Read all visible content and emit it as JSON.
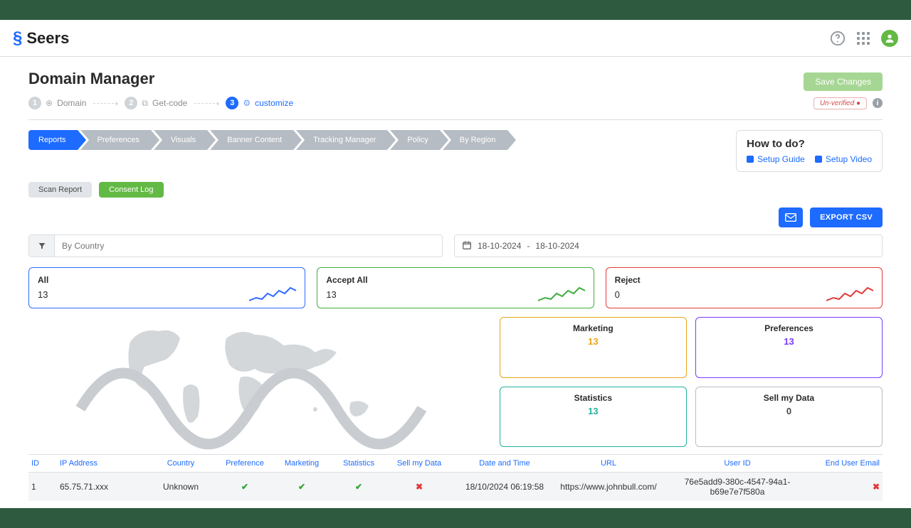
{
  "brand": "Seers",
  "header": {
    "save_label": "Save Changes"
  },
  "page_title": "Domain Manager",
  "steps": [
    {
      "num": "1",
      "label": "Domain"
    },
    {
      "num": "2",
      "label": "Get-code"
    },
    {
      "num": "3",
      "label": "customize"
    }
  ],
  "verification": {
    "label": "Un-verified"
  },
  "tabs": [
    "Reports",
    "Preferences",
    "Visuals",
    "Banner Content",
    "Tracking Manager",
    "Policy",
    "By Region"
  ],
  "help": {
    "title": "How to do?",
    "guide": "Setup Guide",
    "video": "Setup Video"
  },
  "subtabs": {
    "scan": "Scan Report",
    "consent": "Consent Log"
  },
  "actions": {
    "export": "EXPORT CSV"
  },
  "filter": {
    "placeholder": "By Country"
  },
  "date_range": {
    "from": "18-10-2024",
    "sep": "-",
    "to": "18-10-2024"
  },
  "stats": {
    "all": {
      "label": "All",
      "value": "13"
    },
    "accept": {
      "label": "Accept All",
      "value": "13"
    },
    "reject": {
      "label": "Reject",
      "value": "0"
    }
  },
  "mini": {
    "marketing": {
      "label": "Marketing",
      "value": "13"
    },
    "preferences": {
      "label": "Preferences",
      "value": "13"
    },
    "statistics": {
      "label": "Statistics",
      "value": "13"
    },
    "sell": {
      "label": "Sell my Data",
      "value": "0"
    }
  },
  "table": {
    "headers": [
      "ID",
      "IP Address",
      "Country",
      "Preference",
      "Marketing",
      "Statistics",
      "Sell my Data",
      "Date and Time",
      "URL",
      "User ID",
      "End User Email"
    ],
    "rows": [
      {
        "id": "1",
        "ip": "65.75.71.xxx",
        "country": "Unknown",
        "preference": true,
        "marketing": true,
        "statistics": true,
        "sell": false,
        "datetime": "18/10/2024 06:19:58",
        "url": "https://www.johnbull.com/",
        "user_id": "76e5add9-380c-4547-94a1-b69e7e7f580a",
        "email": false
      }
    ]
  }
}
